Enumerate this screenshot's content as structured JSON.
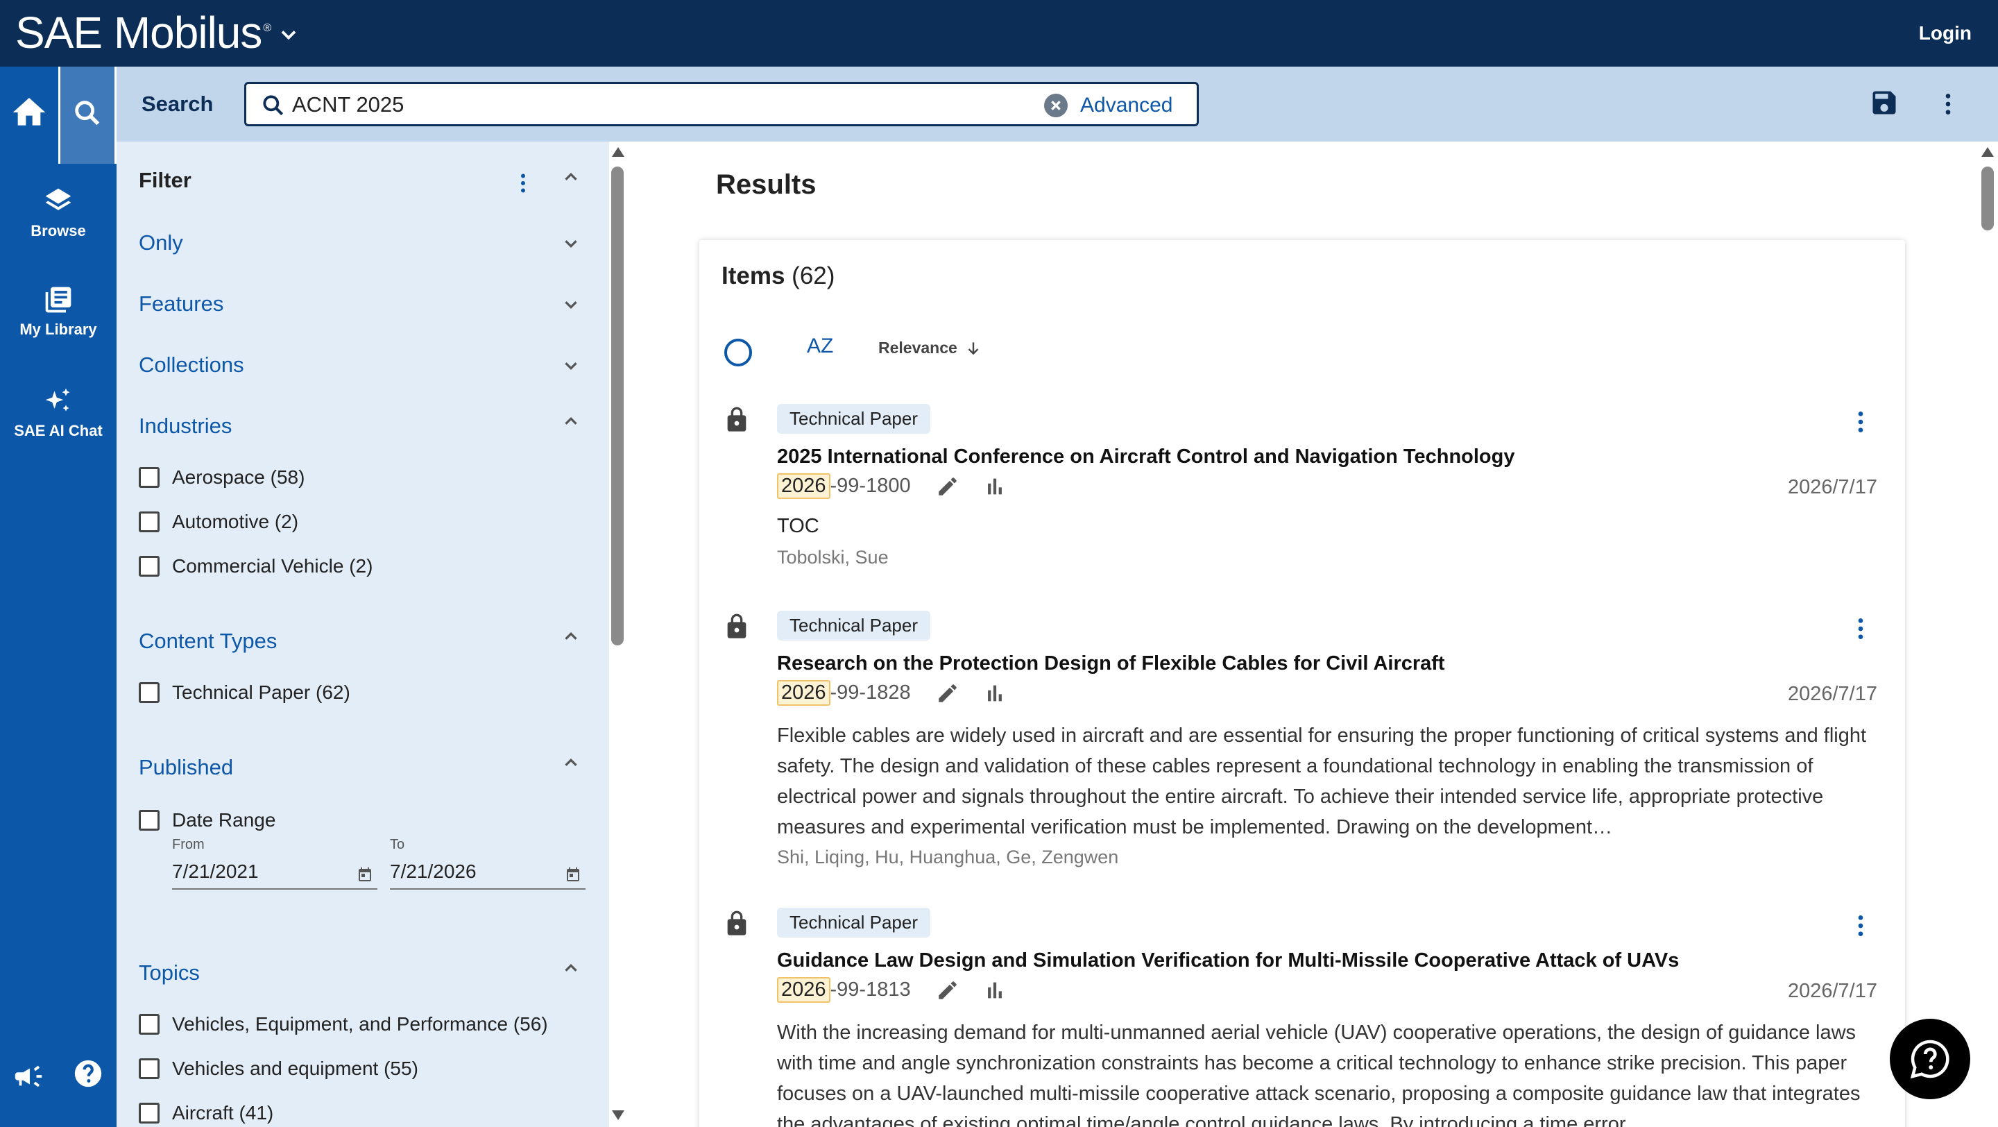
{
  "header": {
    "brand": "SAE Mobilus",
    "brand_mark": "®",
    "login_label": "Login"
  },
  "rail": {
    "items": [
      {
        "label": "Browse",
        "icon": "layers-icon"
      },
      {
        "label": "My Library",
        "icon": "library-icon"
      },
      {
        "label": "SAE AI Chat",
        "icon": "sparkle-icon"
      }
    ]
  },
  "search": {
    "label": "Search",
    "value": "ACNT 2025",
    "advanced_label": "Advanced"
  },
  "filter": {
    "title": "Filter",
    "sections": {
      "only": "Only",
      "features": "Features",
      "collections": "Collections",
      "industries": "Industries",
      "content_types": "Content Types",
      "published": "Published",
      "topics": "Topics"
    },
    "industries": [
      "Aerospace (58)",
      "Automotive (2)",
      "Commercial Vehicle (2)"
    ],
    "content_types": [
      "Technical Paper (62)"
    ],
    "published": {
      "date_range_label": "Date Range",
      "from_label": "From",
      "to_label": "To",
      "from_value": "7/21/2021",
      "to_value": "7/21/2026"
    },
    "topics": [
      "Vehicles, Equipment, and Performance (56)",
      "Vehicles and equipment (55)",
      "Aircraft (41)"
    ]
  },
  "results": {
    "title": "Results",
    "items_label": "Items",
    "items_count": "(62)",
    "sort_az": "AZ",
    "sort_relevance": "Relevance",
    "list": [
      {
        "tag": "Technical Paper",
        "title": "2025 International Conference on Aircraft Control and Navigation Technology",
        "id_highlight": "2026",
        "id_rest": "-99-1800",
        "date": "2026/7/17",
        "toc": "TOC",
        "authors": "Tobolski, Sue"
      },
      {
        "tag": "Technical Paper",
        "title": "Research on the Protection Design of Flexible Cables for Civil Aircraft",
        "id_highlight": "2026",
        "id_rest": "-99-1828",
        "date": "2026/7/17",
        "abstract": "Flexible cables are widely used in aircraft and are essential for ensuring the proper functioning of critical systems and flight safety. The design and validation of these cables represent a foundational technology in enabling the transmission of electrical power and signals throughout the entire aircraft. To achieve their intended service life, appropriate protective measures and experimental verification must be implemented. Drawing on the development…",
        "authors": "Shi, Liqing, Hu, Huanghua, Ge, Zengwen"
      },
      {
        "tag": "Technical Paper",
        "title": "Guidance Law Design and Simulation Verification for Multi-Missile Cooperative Attack of UAVs",
        "id_highlight": "2026",
        "id_rest": "-99-1813",
        "date": "2026/7/17",
        "abstract": "With the increasing demand for multi-unmanned aerial vehicle (UAV) cooperative operations, the design of guidance laws with time and angle synchronization constraints has become a critical technology to enhance strike precision. This paper focuses on a UAV-launched multi-missile cooperative attack scenario, proposing a composite guidance law that integrates the advantages of existing optimal time/angle control guidance laws. By introducing a time error"
      }
    ]
  },
  "colors": {
    "topbar": "#0c2d55",
    "rail": "#0d57a8",
    "search_strip": "#c1d6ea",
    "filter_bg": "#e3edf7",
    "link": "#0d57a8"
  }
}
